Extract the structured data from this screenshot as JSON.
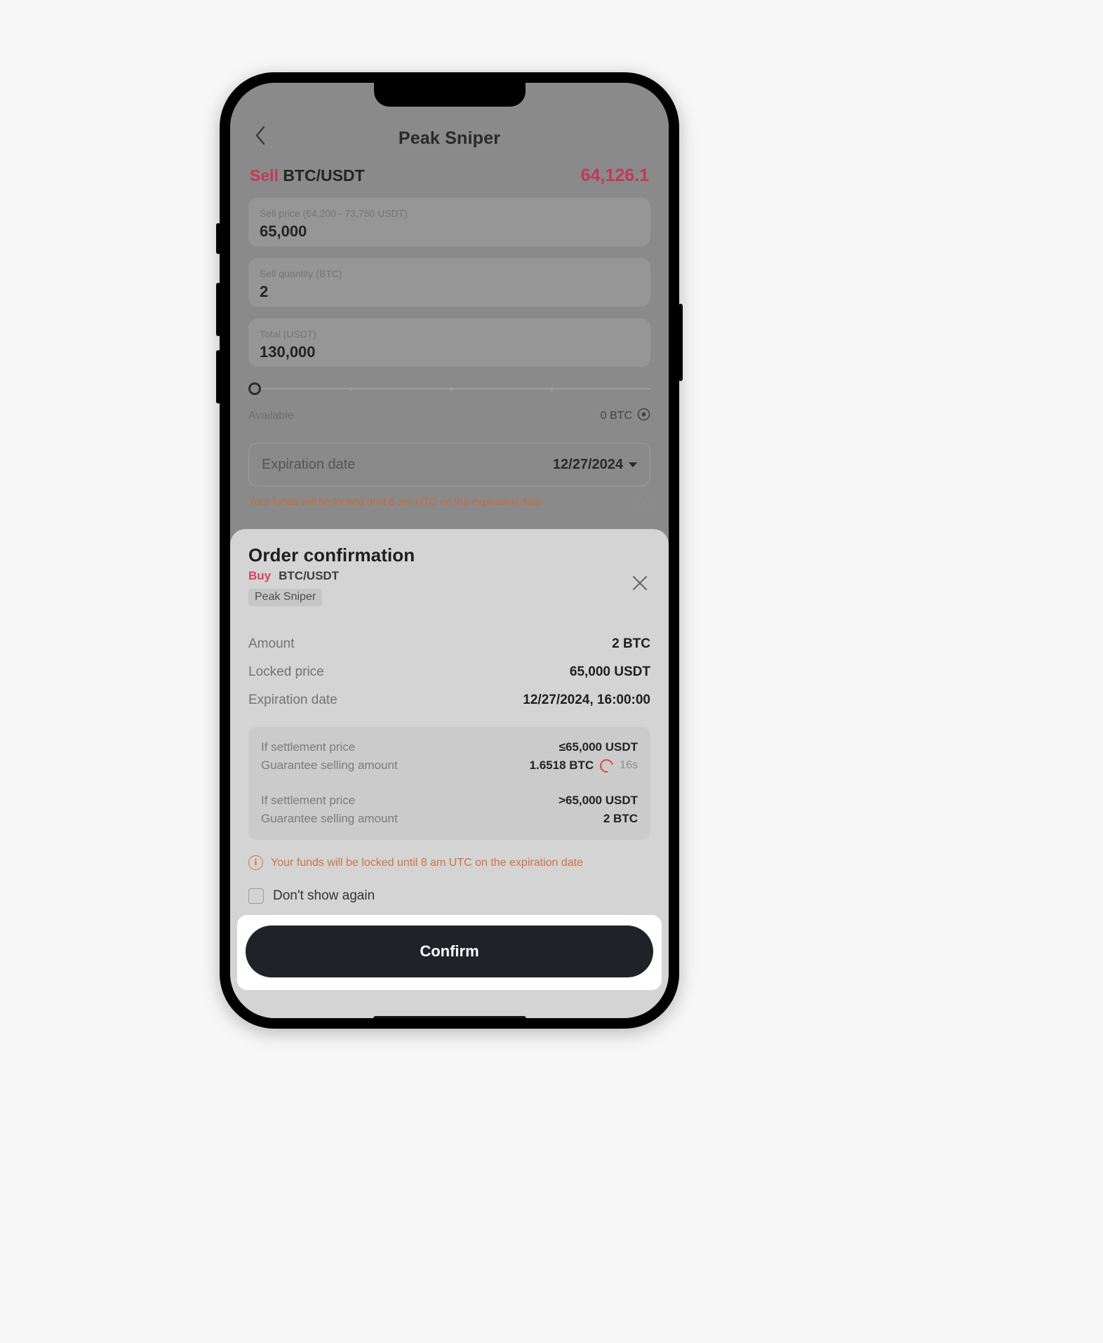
{
  "page": {
    "nav": {
      "back_icon": "chevron-left-icon",
      "title": "Peak Sniper"
    },
    "pair": {
      "side": "Sell",
      "symbol": "BTC/USDT",
      "price": "64,126.1",
      "price_color": "#c2395a"
    },
    "fields": [
      {
        "label": "Sell price (64,200 - 73,750 USDT)",
        "value": "65,000"
      },
      {
        "label": "Sell quantity (BTC)",
        "value": "2"
      },
      {
        "label": "Total (USDT)",
        "value": "130,000"
      }
    ],
    "slider": {
      "value": 0,
      "ticks": [
        0,
        25,
        50,
        75,
        100
      ]
    },
    "available": {
      "label": "Available",
      "value": "0 BTC",
      "icon": "target-circle-icon"
    },
    "expiration": {
      "label": "Expiration date",
      "value": "12/27/2024",
      "caret": "chevron-down-icon"
    },
    "warning": "Your funds will be locked until 8 am UTC on the expiration date",
    "warning_icon": "info-circle-icon"
  },
  "modal": {
    "title": "Order confirmation",
    "side": "Buy",
    "symbol": "BTC/USDT",
    "tag": "Peak Sniper",
    "close_icon": "close-icon",
    "rows": [
      {
        "key": "Amount",
        "value": "2 BTC"
      },
      {
        "key": "Locked price",
        "value": "65,000 USDT"
      },
      {
        "key": "Expiration date",
        "value": "12/27/2024, 16:00:00"
      }
    ],
    "settlement": [
      {
        "condition_key": "If settlement price",
        "condition_value": "≤65,000 USDT",
        "amount_key": "Guarantee selling amount",
        "amount_value": "1.6518 BTC",
        "timer": "16s",
        "timer_icon": "countdown-ring-icon"
      },
      {
        "condition_key": "If settlement price",
        "condition_value": ">65,000 USDT",
        "amount_key": "Guarantee selling amount",
        "amount_value": "2 BTC",
        "timer": "",
        "timer_icon": ""
      }
    ],
    "warning": "Your funds will be locked until 8 am UTC on the expiration date",
    "warning_icon": "info-circle-icon",
    "warning_color": "#d2713f",
    "dont_show_again": "Don't show again",
    "confirm_label": "Confirm"
  }
}
